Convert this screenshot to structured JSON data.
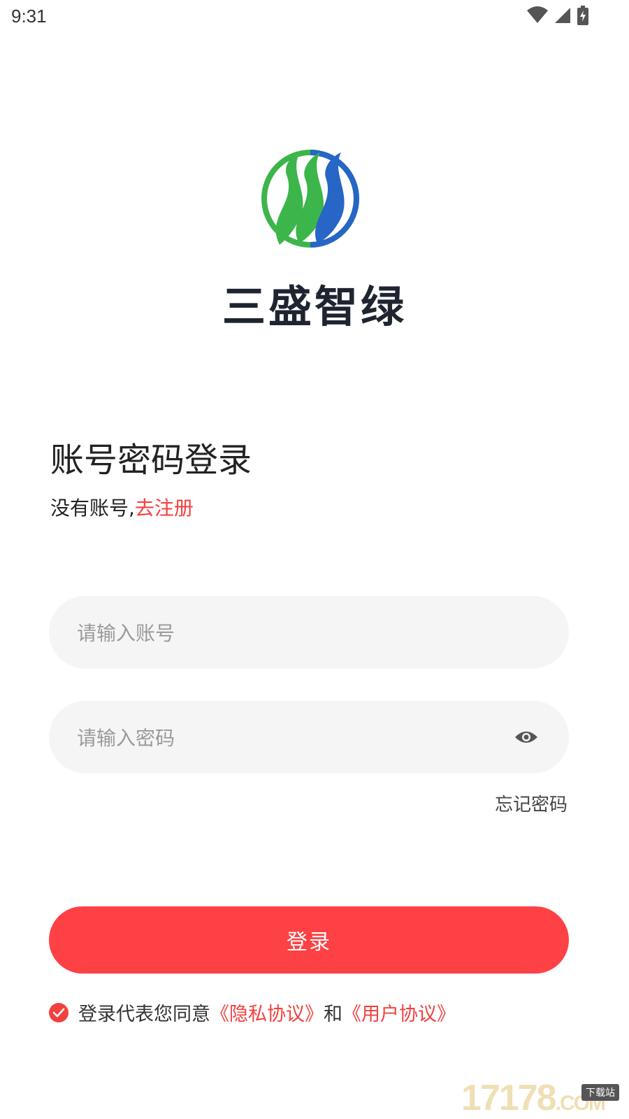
{
  "status_bar": {
    "time": "9:31"
  },
  "app": {
    "name": "三盛智绿"
  },
  "login": {
    "heading": "账号密码登录",
    "no_account_text": "没有账号,",
    "register_link": "去注册",
    "account_placeholder": "请输入账号",
    "password_placeholder": "请输入密码",
    "forgot_password": "忘记密码",
    "login_button": "登录"
  },
  "agreement": {
    "prefix": "登录代表您同意",
    "privacy_link": "《隐私协议》",
    "and_text": "和",
    "user_link": "《用户协议》",
    "checked": true
  },
  "watermark": {
    "text": "17178",
    "suffix": ".COM",
    "tag": "下载站"
  },
  "colors": {
    "accent": "#fd4144",
    "link": "#f2413f",
    "logo_green": "#3cb54a",
    "logo_blue": "#2765c6",
    "input_bg": "#f5f5f5"
  }
}
